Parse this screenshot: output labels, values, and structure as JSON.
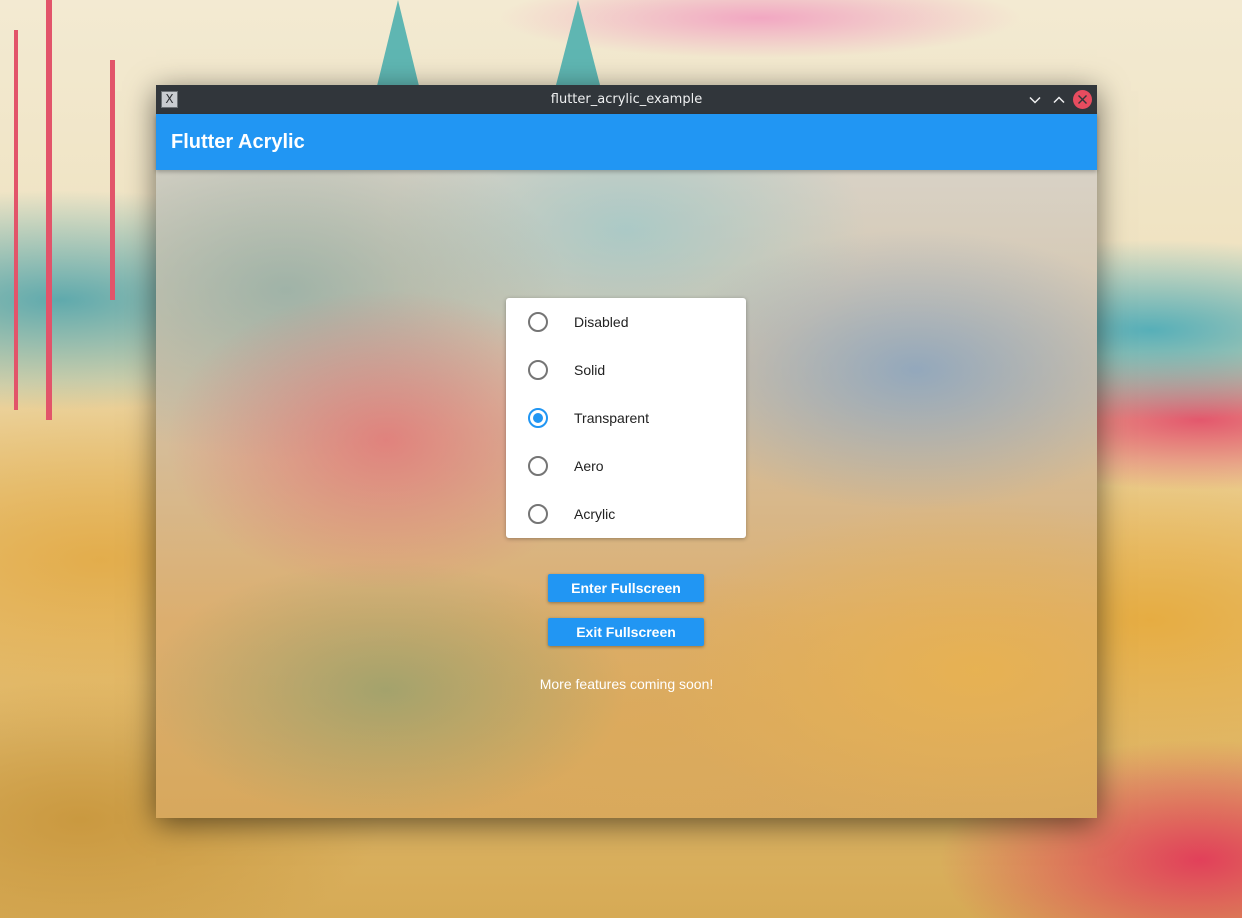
{
  "window": {
    "title": "flutter_acrylic_example",
    "icon": "app-icon",
    "controls": {
      "minimize_icon": "chevron-down-icon",
      "maximize_icon": "chevron-up-icon",
      "close_icon": "close-icon",
      "close_color": "#e74c5f"
    },
    "icon_glyph": "X"
  },
  "appbar": {
    "title": "Flutter Acrylic",
    "color": "#2196f3"
  },
  "effects": {
    "options": [
      {
        "label": "Disabled",
        "selected": false
      },
      {
        "label": "Solid",
        "selected": false
      },
      {
        "label": "Transparent",
        "selected": true
      },
      {
        "label": "Aero",
        "selected": false
      },
      {
        "label": "Acrylic",
        "selected": false
      }
    ],
    "accent": "#2196f3"
  },
  "buttons": {
    "enter_fullscreen": "Enter Fullscreen",
    "exit_fullscreen": "Exit Fullscreen"
  },
  "footer_text": "More features coming soon!"
}
